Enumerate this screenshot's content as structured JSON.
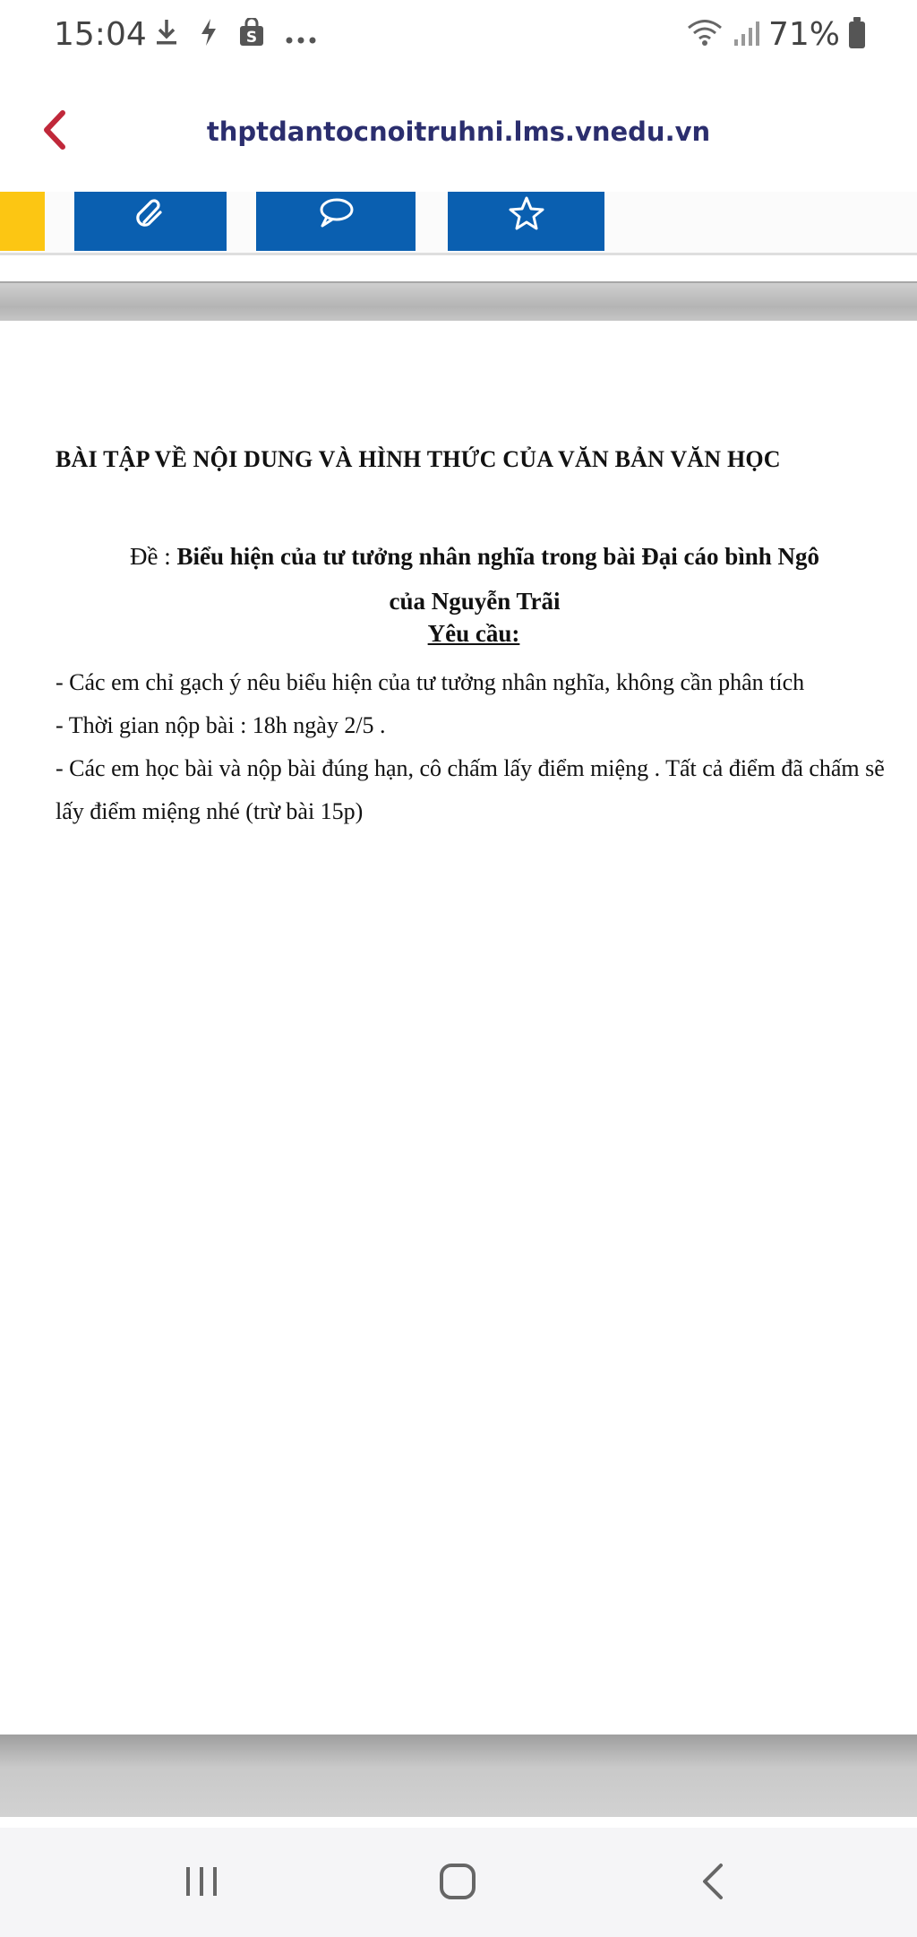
{
  "status_bar": {
    "time": "15:04",
    "battery": "71%",
    "icons": [
      "download-icon",
      "bolt-icon",
      "shop-icon",
      "more-icon",
      "wifi-icon",
      "signal-icon",
      "battery-icon"
    ]
  },
  "header": {
    "url": "thptdantocnoitruhni.lms.vnedu.vn",
    "back_icon": "chevron-left-icon"
  },
  "toolbar": {
    "buttons": [
      {
        "icon": "paperclip-icon"
      },
      {
        "icon": "comment-icon"
      },
      {
        "icon": "star-icon"
      }
    ],
    "accent_color": "#fcc613",
    "button_color": "#0a5fb0"
  },
  "document": {
    "title": "BÀI TẬP VỀ NỘI DUNG VÀ HÌNH THỨC CỦA VĂN BẢN VĂN HỌC",
    "topic_prefix": "Đề : ",
    "topic_line1": "Biểu hiện của tư tưởng nhân nghĩa trong bài Đại cáo bình Ngô",
    "topic_line2": "của Nguyễn Trãi",
    "requirements_title": "Yêu cầu:",
    "requirements": [
      "- Các em chỉ gạch ý nêu biểu hiện của tư tưởng nhân nghĩa, không cần phân tích",
      "- Thời gian nộp bài : 18h ngày 2/5 .",
      "- Các em học bài và nộp bài đúng hạn, cô chấm  lấy điểm miệng . Tất cả điểm đã chấm sẽ lấy điểm miệng nhé (trừ bài 15p)"
    ]
  },
  "nav_bar": {
    "buttons": [
      "recent-apps-icon",
      "home-icon",
      "back-icon"
    ]
  }
}
